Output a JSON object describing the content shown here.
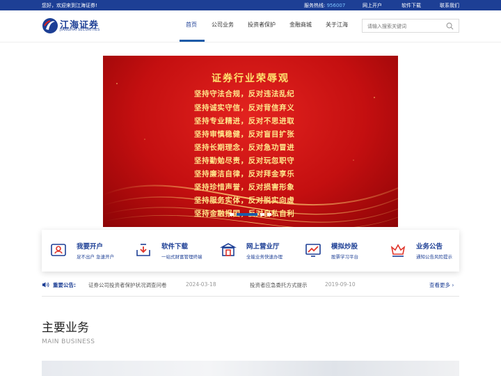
{
  "topbar": {
    "welcome": "您好，欢迎来到江海证券!",
    "hotline_label": "服务热线:",
    "hotline_number": "956007",
    "links": [
      "网上开户",
      "软件下载",
      "联系我们"
    ]
  },
  "logo": {
    "cn": "江海证券",
    "en": "JIANGHAI SECURITIES"
  },
  "nav": {
    "items": [
      "首页",
      "公司业务",
      "投资者保护",
      "金融商城",
      "关于江海"
    ],
    "active_index": 0
  },
  "search": {
    "placeholder": "请输入搜索关键词"
  },
  "banner": {
    "title": "证券行业荣辱观",
    "lines": [
      "坚持守法合规，反对违法乱纪",
      "坚持诚实守信，反对背信弃义",
      "坚持专业精进，反对不思进取",
      "坚持审慎稳健，反对盲目扩张",
      "坚持长期理念，反对急功冒进",
      "坚持勤勉尽责，反对玩忽职守",
      "坚持廉洁自律，反对拜金享乐",
      "坚持珍惜声誉，反对损害形象",
      "坚持服务实体，反对脱实向虚",
      "坚持金融报国，反对自私自利"
    ],
    "slide_count": 4,
    "active_slide": 1
  },
  "services": [
    {
      "title": "我要开户",
      "subtitle": "足不出户 急速开户",
      "icon": "account-open-icon"
    },
    {
      "title": "软件下载",
      "subtitle": "一站式财富管理终端",
      "icon": "download-icon"
    },
    {
      "title": "网上营业厅",
      "subtitle": "全能业务快速办理",
      "icon": "online-hall-icon"
    },
    {
      "title": "模拟炒股",
      "subtitle": "股票学习平台",
      "icon": "stock-chart-icon"
    },
    {
      "title": "业务公告",
      "subtitle": "通知公告风险提示",
      "icon": "crown-notice-icon"
    }
  ],
  "announcements": {
    "label": "重要公告:",
    "items": [
      {
        "text": "证券公司投资者保护状况调查问卷",
        "date": "2024-03-18"
      },
      {
        "text": "投资者应急委托方式提示",
        "date": "2019-09-10"
      }
    ],
    "more": "查看更多"
  },
  "main_business": {
    "title": "主要业务",
    "subtitle": "MAIN BUSINESS"
  },
  "colors": {
    "brand": "#1d3f95",
    "banner_red": "#c40f10",
    "banner_text": "#ffe58a"
  }
}
